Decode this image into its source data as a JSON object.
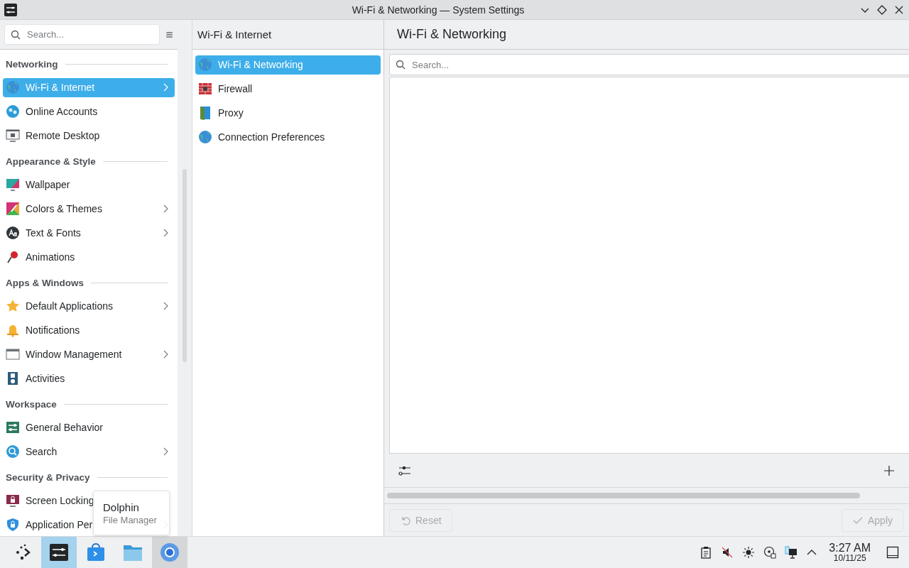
{
  "window": {
    "title": "Wi-Fi & Networking — System Settings"
  },
  "sidebar": {
    "search": {
      "placeholder": "Search..."
    },
    "sections": [
      {
        "heading": "Networking",
        "items": [
          {
            "label": "Wi-Fi & Internet",
            "selected": true,
            "expandable": true
          },
          {
            "label": "Online Accounts",
            "selected": false,
            "expandable": false
          },
          {
            "label": "Remote Desktop",
            "selected": false,
            "expandable": false
          }
        ]
      },
      {
        "heading": "Appearance & Style",
        "items": [
          {
            "label": "Wallpaper",
            "selected": false,
            "expandable": false
          },
          {
            "label": "Colors & Themes",
            "selected": false,
            "expandable": true
          },
          {
            "label": "Text & Fonts",
            "selected": false,
            "expandable": true
          },
          {
            "label": "Animations",
            "selected": false,
            "expandable": false
          }
        ]
      },
      {
        "heading": "Apps & Windows",
        "items": [
          {
            "label": "Default Applications",
            "selected": false,
            "expandable": true
          },
          {
            "label": "Notifications",
            "selected": false,
            "expandable": false
          },
          {
            "label": "Window Management",
            "selected": false,
            "expandable": true
          },
          {
            "label": "Activities",
            "selected": false,
            "expandable": false
          }
        ]
      },
      {
        "heading": "Workspace",
        "items": [
          {
            "label": "General Behavior",
            "selected": false,
            "expandable": false
          },
          {
            "label": "Search",
            "selected": false,
            "expandable": true
          }
        ]
      },
      {
        "heading": "Security & Privacy",
        "items": [
          {
            "label": "Screen Locking",
            "selected": false,
            "expandable": false
          },
          {
            "label": "Application Per",
            "selected": false,
            "expandable": true
          }
        ]
      }
    ]
  },
  "subpanel": {
    "title": "Wi-Fi & Internet",
    "items": [
      {
        "label": "Wi-Fi & Networking",
        "selected": true
      },
      {
        "label": "Firewall",
        "selected": false
      },
      {
        "label": "Proxy",
        "selected": false
      },
      {
        "label": "Connection Preferences",
        "selected": false
      }
    ]
  },
  "main": {
    "title": "Wi-Fi & Networking",
    "search": {
      "placeholder": "Search..."
    },
    "buttons": [
      {
        "label": "Reset",
        "kind": "reset",
        "disabled": true
      },
      {
        "label": "Apply",
        "kind": "apply",
        "disabled": true
      }
    ]
  },
  "tooltip": {
    "title": "Dolphin",
    "subtitle": "File Manager"
  },
  "taskbar": {
    "apps": [
      {
        "active": true,
        "hovered": false
      },
      {
        "active": false,
        "hovered": false
      },
      {
        "active": false,
        "hovered": false
      },
      {
        "active": false,
        "hovered": true
      }
    ],
    "clock": {
      "time": "3:27 AM",
      "date": "10/11/25"
    }
  }
}
